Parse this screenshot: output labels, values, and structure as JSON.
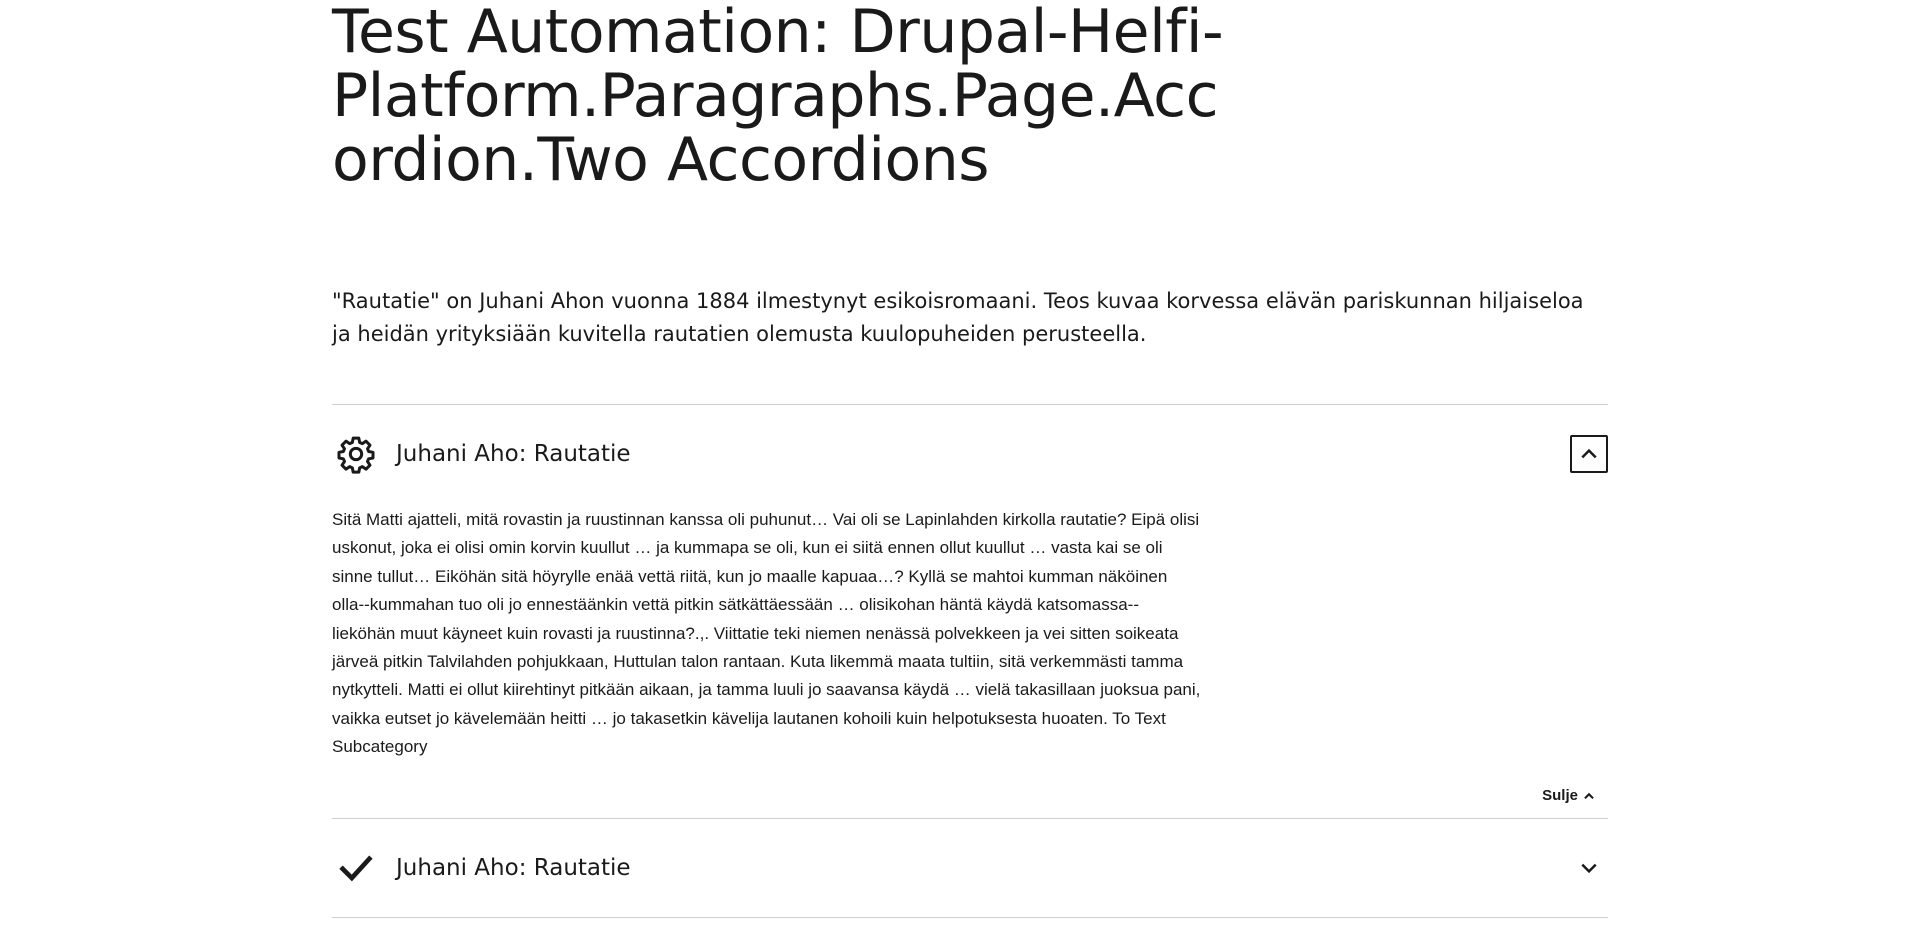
{
  "page": {
    "title": "Test Automation: Drupal-Helfi-Platform.Paragraphs.Page.Accordion.Two Accordions",
    "lead": "\"Rautatie\" on Juhani Ahon vuonna 1884 ilmestynyt esikoisromaani. Teos kuvaa korvessa elävän pariskunnan hiljaiseloa ja heidän yrityksiään kuvitella rautatien olemusta kuulopuheiden perusteella."
  },
  "accordion": {
    "items": [
      {
        "title": "Juhani Aho: Rautatie",
        "icon": "gear-icon",
        "expanded": true,
        "body": "Sitä Matti ajatteli, mitä rovastin ja ruustinnan kanssa oli puhunut… Vai oli se Lapinlahden kirkolla rautatie? Eipä olisi uskonut, joka ei olisi omin korvin kuullut … ja kummapa se oli, kun ei siitä ennen ollut kuullut … vasta kai se oli sinne tullut… Eiköhän sitä höyrylle enää vettä riitä, kun jo maalle kapuaa…? Kyllä se mahtoi kumman näköinen olla--kummahan tuo oli jo ennestäänkin vettä pitkin sätkättäessään … olisikohan häntä käydä katsomassa--lieköhän muut käyneet kuin rovasti ja ruustinna?.,. Viittatie teki niemen nenässä polvekkeen ja vei sitten soikeata järveä pitkin Talvilahden pohjukkaan, Huttulan talon rantaan. Kuta likemmä maata tultiin, sitä verkemmästi tamma nytkytteli. Matti ei ollut kiirehtinyt pitkään aikaan, ja tamma luuli jo saavansa käydä … vielä takasillaan juoksua pani, vaikka eutset jo kävelemään heitti … jo takasetkin kävelija lautanen kohoili kuin helpotuksesta huoaten. To Text Subcategory",
        "close_label": "Sulje"
      },
      {
        "title": "Juhani Aho: Rautatie",
        "icon": "checkmark-icon",
        "expanded": false
      }
    ]
  }
}
